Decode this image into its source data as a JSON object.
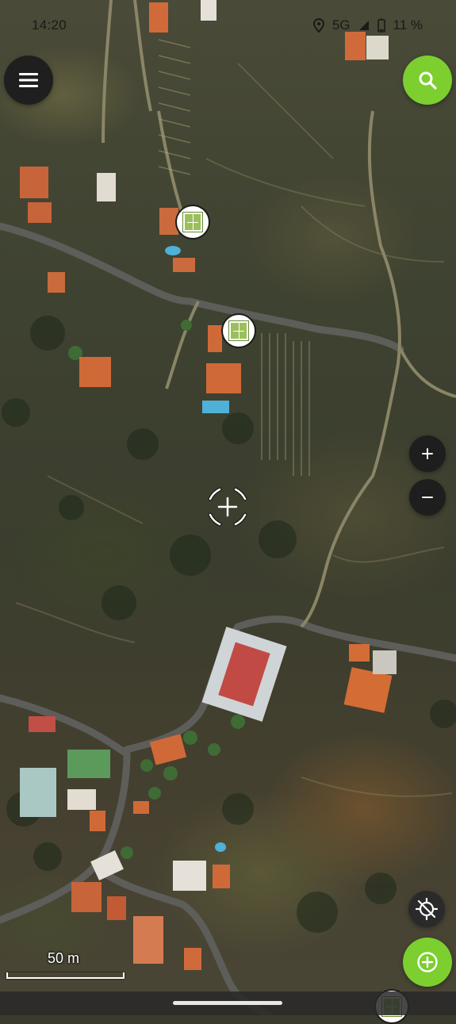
{
  "status_bar": {
    "time": "14:20",
    "network": "5G",
    "battery": "11 %",
    "icons": [
      "location-icon",
      "signal-icon",
      "battery-icon"
    ]
  },
  "map": {
    "type": "satellite",
    "scale_label": "50 m",
    "markers": [
      {
        "icon": "tennis-court-icon"
      },
      {
        "icon": "tennis-court-icon"
      },
      {
        "icon": "tennis-court-icon"
      }
    ]
  },
  "controls": {
    "menu": {
      "icon": "hamburger-menu-icon"
    },
    "search": {
      "icon": "search-icon"
    },
    "zoom_in": {
      "icon": "plus-icon",
      "label": "+"
    },
    "zoom_out": {
      "icon": "minus-icon",
      "label": "−"
    },
    "locate": {
      "icon": "gps-off-icon"
    },
    "add": {
      "icon": "add-circle-icon"
    }
  },
  "colors": {
    "accent_green": "#7ccf2e",
    "dark_button": "#1f1f1f"
  }
}
